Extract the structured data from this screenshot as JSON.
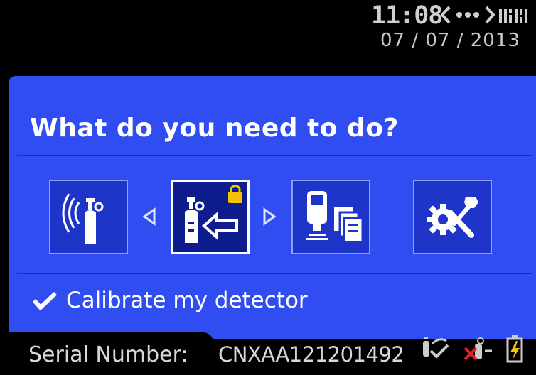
{
  "status_bar": {
    "time": "11:08",
    "date": "07 / 07 / 2013",
    "icons": [
      "link-icon",
      "signal-icon"
    ]
  },
  "main": {
    "title": "What do you need to do?",
    "tiles": [
      {
        "icon": "wireless-cylinder-icon",
        "selected": false
      },
      {
        "icon": "locked-calibrate-icon",
        "selected": true
      },
      {
        "icon": "detector-documents-icon",
        "selected": false
      },
      {
        "icon": "tools-settings-icon",
        "selected": false
      }
    ],
    "nav_icons": [
      "chevron-left-icon",
      "chevron-right-icon"
    ],
    "status_text": "Calibrate my detector"
  },
  "footer": {
    "serial_label": "Serial Number:",
    "serial_value": "CNXAA121201492",
    "icons": [
      "calibration-ok-icon",
      "bump-failed-icon",
      "battery-charging-icon"
    ]
  },
  "colors": {
    "panel": "#2f4df0",
    "background": "#000000",
    "text": "#ffffff",
    "alert": "#e0202a",
    "lock": "#f2c400"
  }
}
